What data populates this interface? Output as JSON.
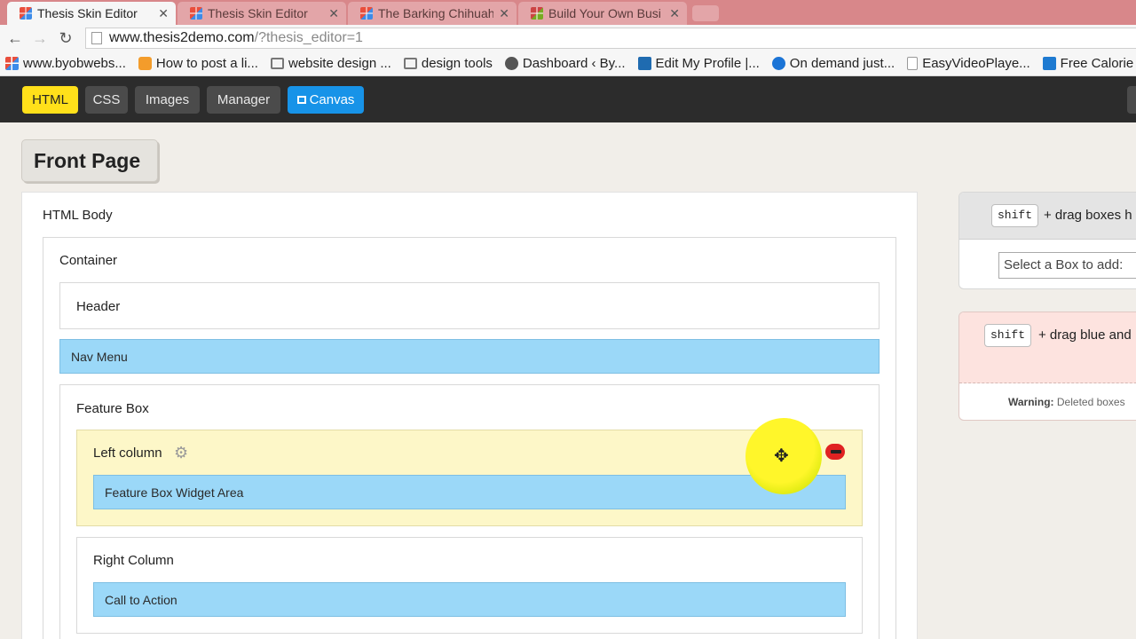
{
  "browser": {
    "tabs": [
      {
        "title": "Thesis Skin Editor",
        "active": true
      },
      {
        "title": "Thesis Skin Editor",
        "active": false
      },
      {
        "title": "The Barking Chihuah",
        "active": false
      },
      {
        "title": "Build Your Own Busi",
        "active": false
      }
    ],
    "url_host": "www.thesis2demo.com",
    "url_path": "/?thesis_editor=1",
    "bookmarks": [
      {
        "label": "www.byobwebs...",
        "icon": "grid-icon"
      },
      {
        "label": "How to post a li...",
        "icon": "rss-icon"
      },
      {
        "label": "website design ...",
        "icon": "folder-icon"
      },
      {
        "label": "design tools",
        "icon": "folder-icon"
      },
      {
        "label": "Dashboard ‹ By...",
        "icon": "wordpress-icon"
      },
      {
        "label": "Edit My Profile |...",
        "icon": "linkedin-icon"
      },
      {
        "label": "On demand just...",
        "icon": "ondemand-icon"
      },
      {
        "label": "EasyVideoPlaye...",
        "icon": "page-icon"
      },
      {
        "label": "Free Calorie C",
        "icon": "calorie-icon"
      }
    ]
  },
  "toolbar": {
    "html": "HTML",
    "css": "CSS",
    "images": "Images",
    "manager": "Manager",
    "canvas": "Canvas",
    "active_color": "#ffe01a",
    "canvas_color": "#1793e8"
  },
  "page_title": "Front Page",
  "tree": {
    "html_body": "HTML Body",
    "container": "Container",
    "header": "Header",
    "nav_menu": "Nav Menu",
    "feature_box": "Feature Box",
    "left_column": "Left column",
    "feature_widget": "Feature Box Widget Area",
    "right_column": "Right Column",
    "call_to_action": "Call to Action"
  },
  "side": {
    "shift_key": "shift",
    "drag_hint_1": "+ drag boxes h",
    "select_placeholder": "Select a Box to add:",
    "drag_hint_2": "+ drag blue and",
    "warning_label": "Warning:",
    "warning_text": "Deleted boxes"
  }
}
